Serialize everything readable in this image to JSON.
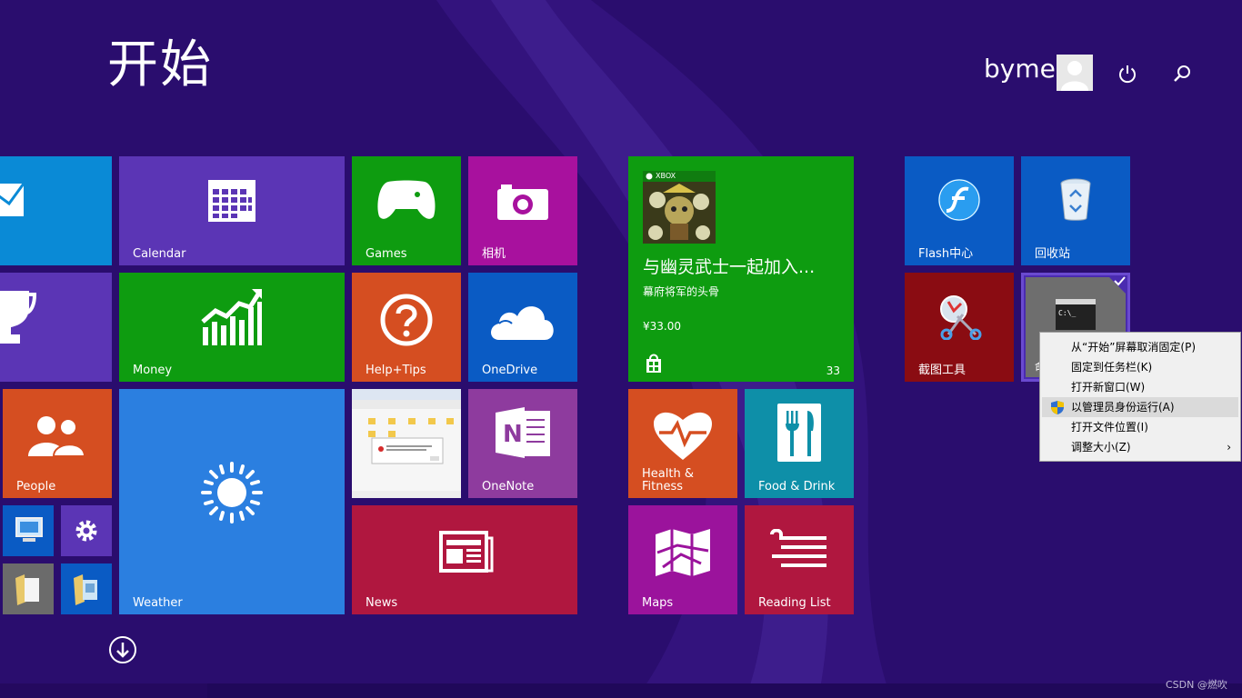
{
  "start": {
    "title": "开始",
    "username": "byme"
  },
  "tiles": {
    "calendar": "Calendar",
    "games": "Games",
    "camera": "相机",
    "money": "Money",
    "help": "Help+Tips",
    "onedrive": "OneDrive",
    "people": "People",
    "onenote": "OneNote",
    "weather": "Weather",
    "news": "News",
    "flash": "Flash中心",
    "recycle": "回收站",
    "snipping": "截图工具",
    "health_line1": "Health &",
    "health_line2": "Fitness",
    "food": "Food & Drink",
    "maps": "Maps",
    "reading": "Reading List",
    "cmd_partial": "命"
  },
  "store_tile": {
    "badge": "XBOX",
    "headline": "与幽灵武士一起加入...",
    "subtitle": "幕府将军的头骨",
    "price": "¥33.00",
    "count": "33"
  },
  "context_menu": {
    "items": [
      "从“开始”屏幕取消固定(P)",
      "固定到任务栏(K)",
      "打开新窗口(W)",
      "以管理员身份运行(A)",
      "打开文件位置(I)",
      "调整大小(Z)"
    ],
    "highlighted_index": 3
  },
  "watermark": "CSDN @燃吹",
  "colors": {
    "background": "#2a0d6e",
    "mail": "#0a8ad6",
    "calendar": "#5b35b5",
    "games": "#0e9c10",
    "camera": "#a8119e",
    "money": "#0e9c10",
    "help": "#d54e21",
    "onedrive": "#0a5bc4",
    "people": "#d54e21",
    "weather": "#2b7fe0",
    "news": "#b0173f",
    "onenote": "#8e3b9e",
    "store": "#0e9c10",
    "health": "#d54e21",
    "food": "#0e8fa8",
    "maps": "#9b139c",
    "reading": "#b0173f",
    "flash": "#0a5bc4",
    "recycle": "#0a5bc4",
    "snipping": "#8a0c12",
    "cmd": "#4a2bb0"
  },
  "icons": [
    "mail-icon",
    "calendar-icon",
    "gamepad-icon",
    "camera-icon",
    "trophy-icon",
    "chart-icon",
    "help-icon",
    "cloud-icon",
    "people-icon",
    "desktop-icon",
    "gear-icon",
    "folder-icon",
    "sun-icon",
    "onenote-icon",
    "news-icon",
    "store-icon",
    "heart-icon",
    "fork-knife-icon",
    "map-icon",
    "reading-list-icon",
    "flash-icon",
    "recycle-bin-icon",
    "scissors-icon",
    "cmd-icon",
    "power-icon",
    "search-icon",
    "down-arrow-icon",
    "shield-icon",
    "chevron-right-icon"
  ]
}
